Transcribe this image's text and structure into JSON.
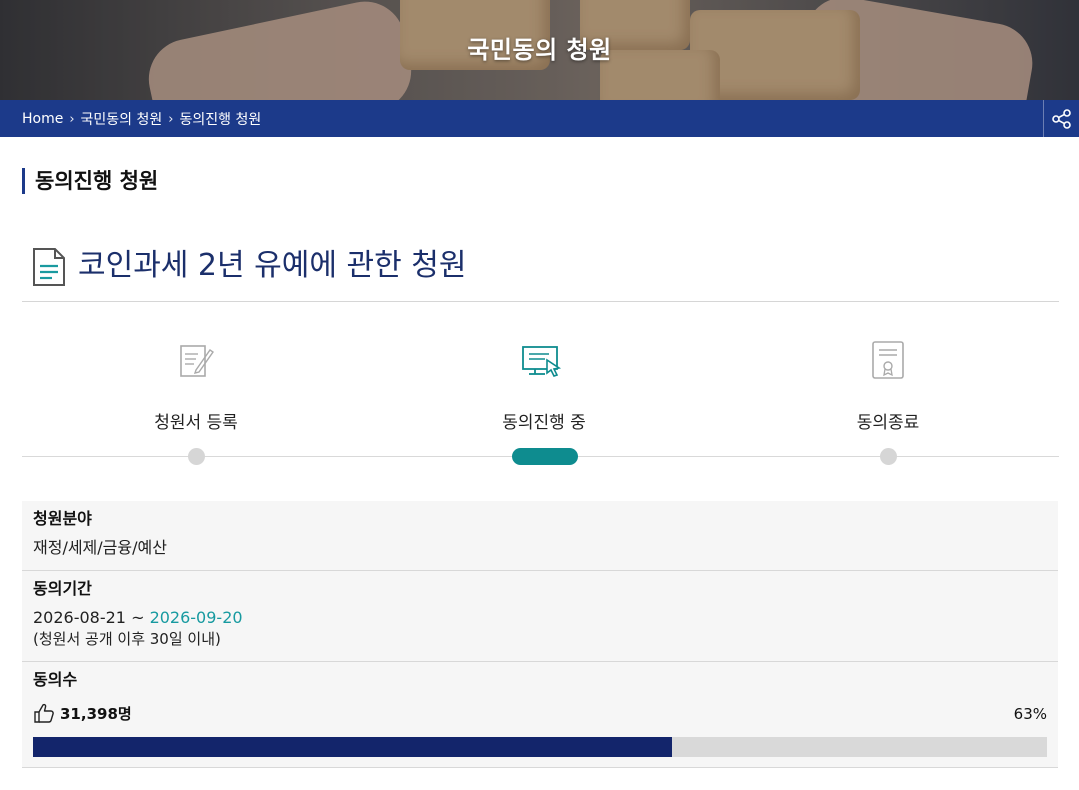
{
  "hero": {
    "title": "국민동의 청원"
  },
  "breadcrumb": {
    "items": [
      "Home",
      "국민동의 청원",
      "동의진행 청원"
    ],
    "separator": "›",
    "share_icon": "share-icon"
  },
  "section": {
    "title": "동의진행 청원"
  },
  "petition": {
    "title": "코인과세 2년 유예에 관한 청원",
    "icon": "document-icon"
  },
  "steps": [
    {
      "label": "청원서 등록",
      "icon": "edit-document-icon",
      "state": "done"
    },
    {
      "label": "동의진행 중",
      "icon": "computer-click-icon",
      "state": "active"
    },
    {
      "label": "동의종료",
      "icon": "certificate-icon",
      "state": "pending"
    }
  ],
  "info": {
    "field": {
      "label": "청원분야",
      "value": "재정/세제/금융/예산"
    },
    "period": {
      "label": "동의기간",
      "start": "2026-08-21",
      "separator": " ~ ",
      "end": "2026-09-20",
      "note": "(청원서 공개 이후 30일 이내)"
    },
    "count": {
      "label": "동의수",
      "value": "31,398명",
      "percent": "63%",
      "progress": 0.63,
      "icon": "thumbs-up-icon"
    }
  },
  "colors": {
    "brand": "#1c3a8a",
    "active_step": "#0e8c8f",
    "progress_fill": "#13256b",
    "date_end": "#179aa0"
  }
}
